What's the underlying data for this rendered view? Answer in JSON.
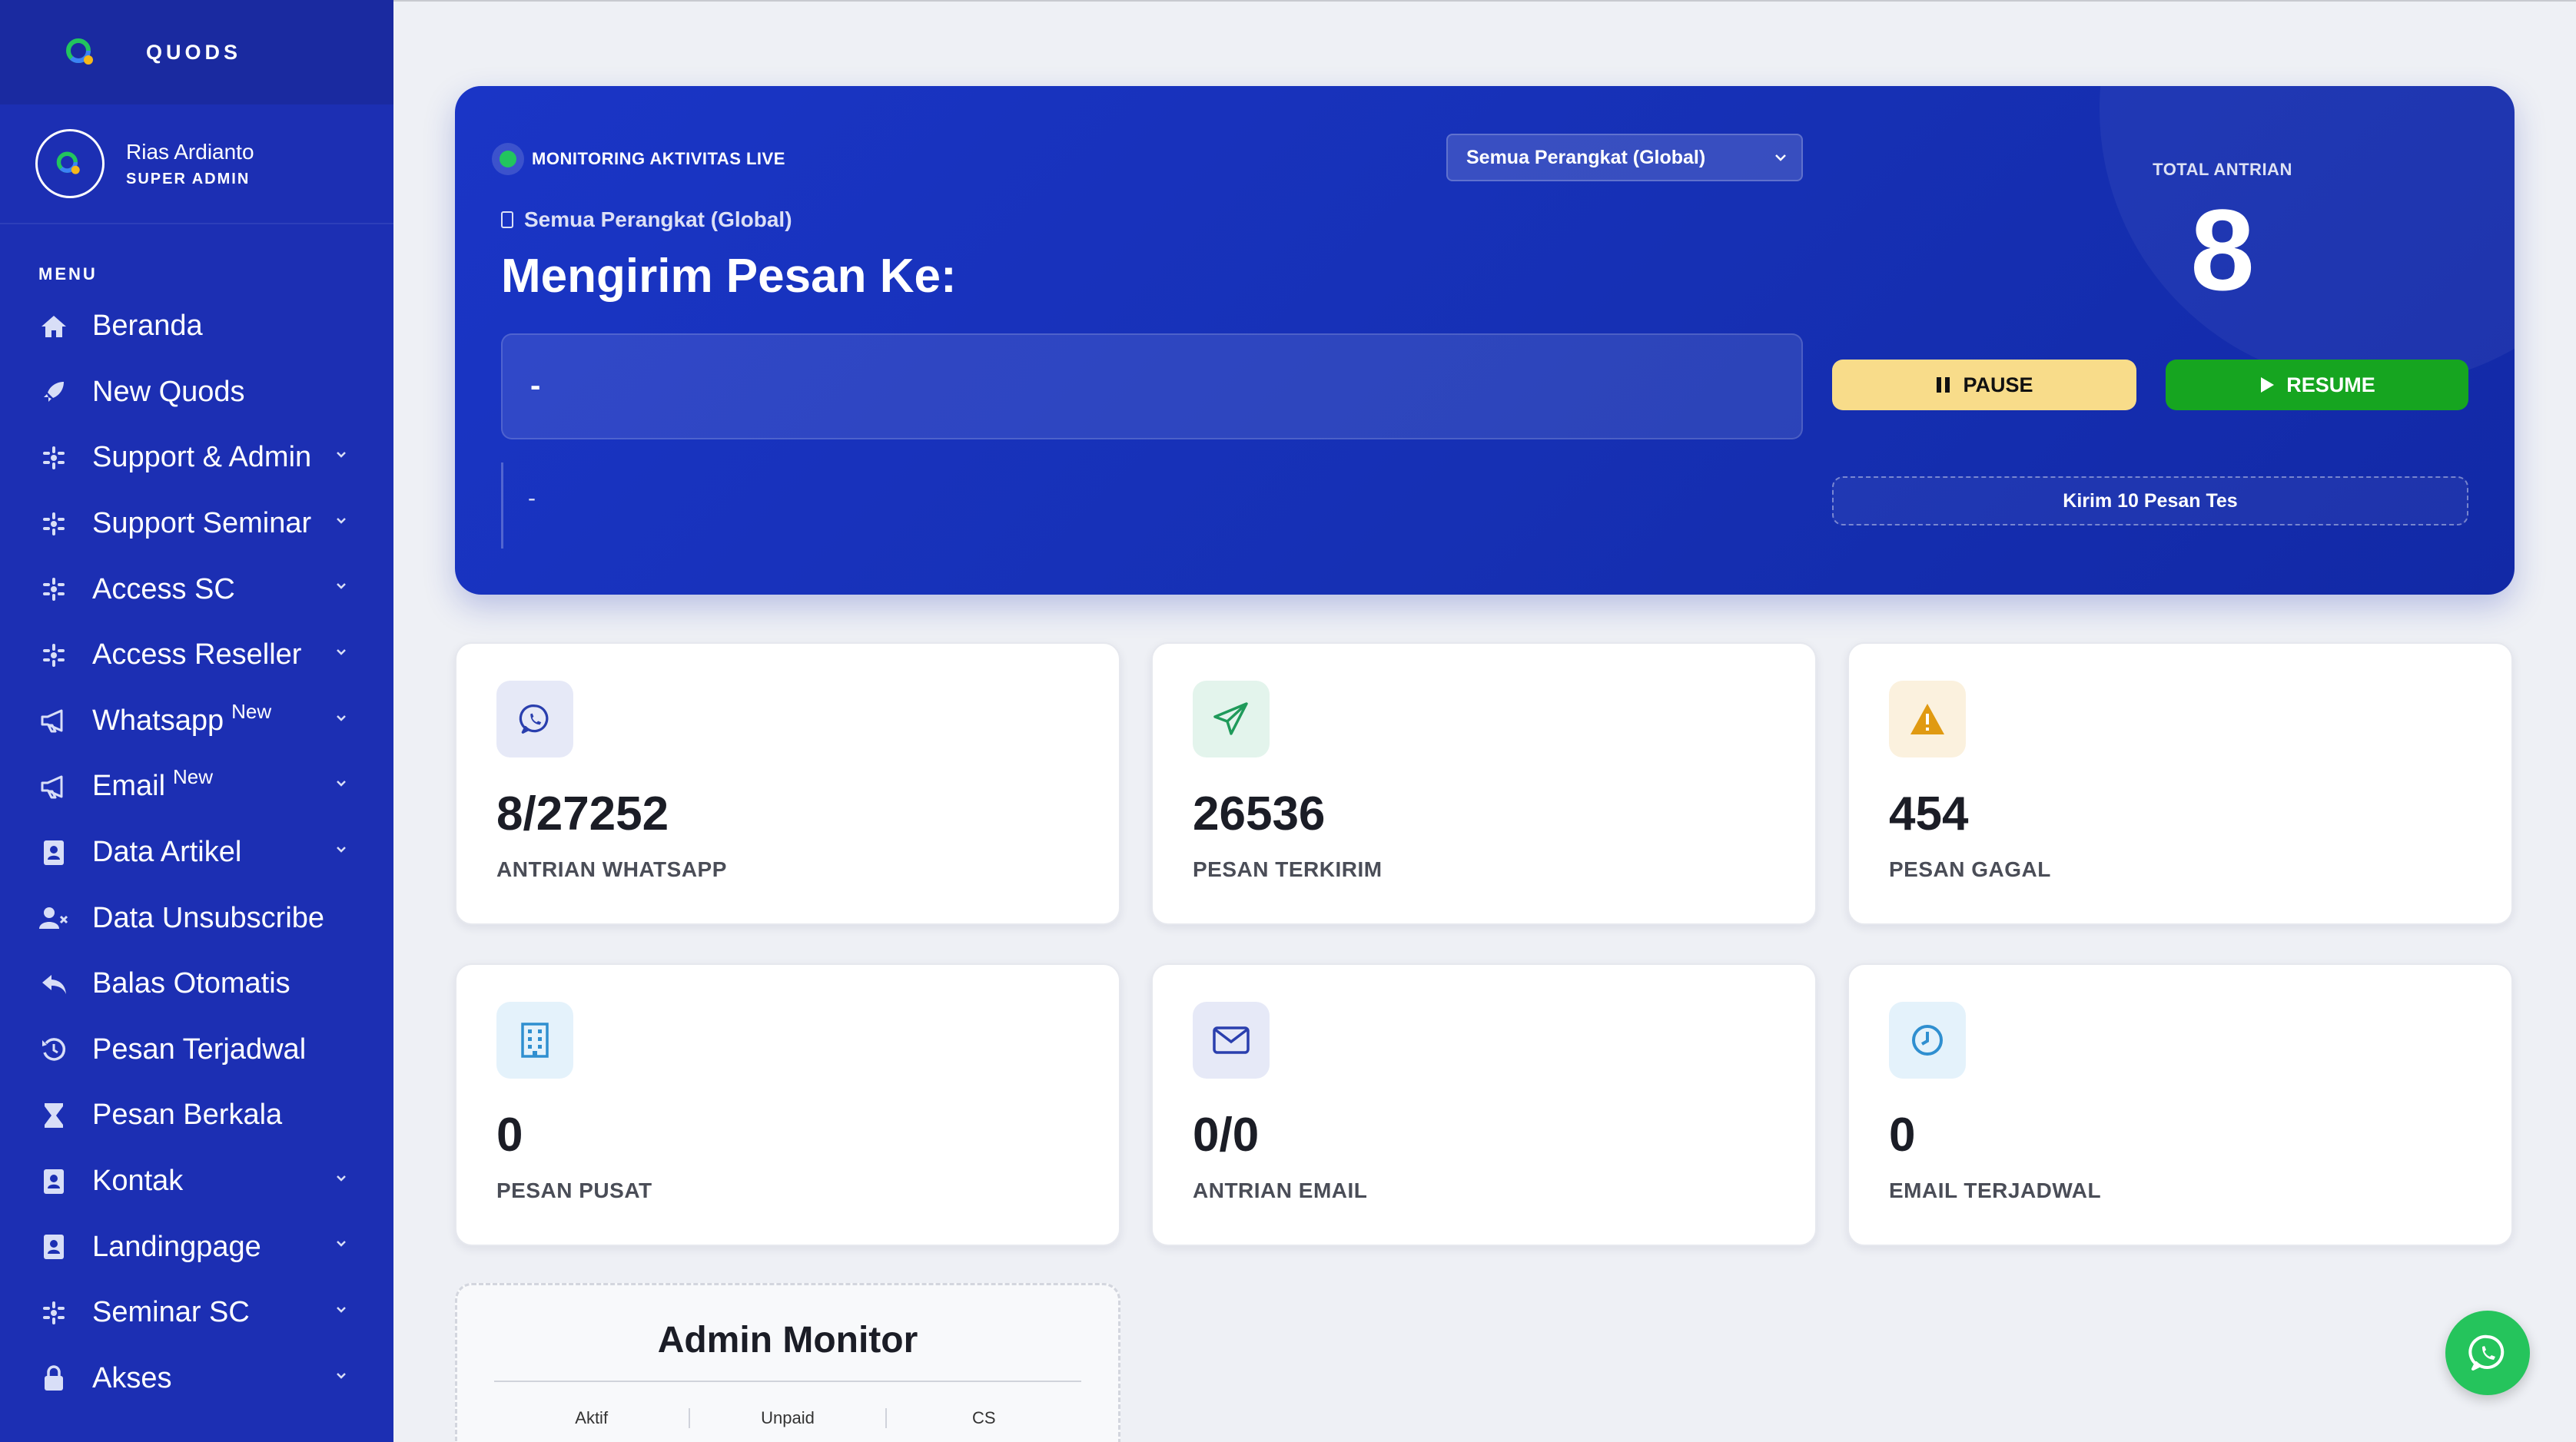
{
  "sidebar": {
    "brand": "QUODS",
    "user": {
      "name": "Rias Ardianto",
      "role": "SUPER ADMIN"
    },
    "menu_title": "MENU",
    "items": [
      {
        "label": "Beranda",
        "icon": "home-icon",
        "badge": "",
        "has_chevron": false
      },
      {
        "label": "New Quods",
        "icon": "rocket-icon",
        "badge": "",
        "has_chevron": false
      },
      {
        "label": "Support & Admin",
        "icon": "grid-icon",
        "badge": "",
        "has_chevron": true
      },
      {
        "label": "Support Seminar",
        "icon": "grid-icon",
        "badge": "",
        "has_chevron": true
      },
      {
        "label": "Access SC",
        "icon": "grid-icon",
        "badge": "",
        "has_chevron": true
      },
      {
        "label": "Access Reseller",
        "icon": "grid-icon",
        "badge": "",
        "has_chevron": true
      },
      {
        "label": "Whatsapp",
        "icon": "megaphone-icon",
        "badge": "New",
        "has_chevron": true
      },
      {
        "label": "Email",
        "icon": "megaphone-icon",
        "badge": "New",
        "has_chevron": true
      },
      {
        "label": "Data Artikel",
        "icon": "contact-book-icon",
        "badge": "",
        "has_chevron": true
      },
      {
        "label": "Data Unsubscribe",
        "icon": "user-remove-icon",
        "badge": "",
        "has_chevron": false
      },
      {
        "label": "Balas Otomatis",
        "icon": "reply-all-icon",
        "badge": "",
        "has_chevron": false
      },
      {
        "label": "Pesan Terjadwal",
        "icon": "history-icon",
        "badge": "",
        "has_chevron": false
      },
      {
        "label": "Pesan Berkala",
        "icon": "hourglass-icon",
        "badge": "",
        "has_chevron": false
      },
      {
        "label": "Kontak",
        "icon": "contact-book-icon",
        "badge": "",
        "has_chevron": true
      },
      {
        "label": "Landingpage",
        "icon": "contact-book-icon",
        "badge": "",
        "has_chevron": true
      },
      {
        "label": "Seminar SC",
        "icon": "grid-icon",
        "badge": "",
        "has_chevron": true
      },
      {
        "label": "Akses",
        "icon": "lock-icon",
        "badge": "",
        "has_chevron": true
      }
    ]
  },
  "hero": {
    "live_label": "MONITORING AKTIVITAS LIVE",
    "device_select": "Semua Perangkat (Global)",
    "device_line": "Semua Perangkat (Global)",
    "heading": "Mengirim Pesan Ke:",
    "target": "-",
    "message": "-",
    "total_label": "TOTAL ANTRIAN",
    "total_value": "8",
    "pause_label": "PAUSE",
    "resume_label": "RESUME",
    "test_label": "Kirim 10 Pesan Tes"
  },
  "stats": [
    {
      "value": "8/27252",
      "label": "ANTRIAN WHATSAPP",
      "icon": "whatsapp-icon",
      "icon_color": "#2a3fae",
      "icon_bg": "#e6e9f7"
    },
    {
      "value": "26536",
      "label": "PESAN TERKIRIM",
      "icon": "paper-plane-icon",
      "icon_color": "#1f9a5a",
      "icon_bg": "#e3f4ec"
    },
    {
      "value": "454",
      "label": "PESAN GAGAL",
      "icon": "warning-icon",
      "icon_color": "#e09a12",
      "icon_bg": "#fbf1de"
    },
    {
      "value": "0",
      "label": "PESAN PUSAT",
      "icon": "building-icon",
      "icon_color": "#2f8fd0",
      "icon_bg": "#e4f2fb"
    },
    {
      "value": "0/0",
      "label": "ANTRIAN EMAIL",
      "icon": "envelope-icon",
      "icon_color": "#2a3fae",
      "icon_bg": "#e6e9f7"
    },
    {
      "value": "0",
      "label": "EMAIL TERJADWAL",
      "icon": "clock-icon",
      "icon_color": "#2f8fd0",
      "icon_bg": "#e4f2fb"
    }
  ],
  "admin_monitor": {
    "title": "Admin Monitor",
    "columns": [
      "Aktif",
      "Unpaid",
      "CS"
    ]
  }
}
